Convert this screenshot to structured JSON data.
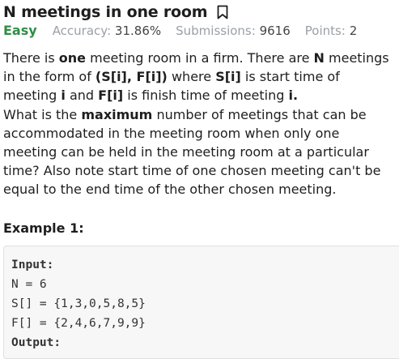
{
  "problem": {
    "title": "N meetings in one room",
    "difficulty": "Easy",
    "stats": {
      "accuracy_label": "Accuracy:",
      "accuracy_value": "31.86%",
      "submissions_label": "Submissions:",
      "submissions_value": "9616",
      "points_label": "Points:",
      "points_value": "2"
    },
    "description": {
      "p1_a": "There is ",
      "p1_b": "one",
      "p1_c": " meeting room in a firm. There are ",
      "p1_d": "N",
      "p1_e": " meetings in the form of ",
      "p1_f": "(S[i], F[i])",
      "p1_g": " where ",
      "p1_h": "S[i]",
      "p1_i": " is start time of meeting ",
      "p1_j": "i",
      "p1_k": " and ",
      "p1_l": "F[i]",
      "p1_m": " is finish time of meeting ",
      "p1_n": "i.",
      "p2_a": "What is the ",
      "p2_b": "maximum",
      "p2_c": " number of meetings that can be accommodated in the meeting room when only one meeting can be held in the meeting room at a particular time? Also note start time of one chosen meeting can't be equal to the end time of the other chosen meeting."
    },
    "example": {
      "title": "Example 1:",
      "input_label": "Input:",
      "lines": [
        "N = 6",
        "S[] = {1,3,0,5,8,5}",
        "F[] = {2,4,6,7,9,9}"
      ],
      "output_label": "Output:"
    }
  },
  "colors": {
    "difficulty": "#2f8d46",
    "meta_label": "#9aa0a6",
    "code_bg": "#f7f7f7"
  },
  "icons": {
    "bookmark": "bookmark-icon"
  }
}
